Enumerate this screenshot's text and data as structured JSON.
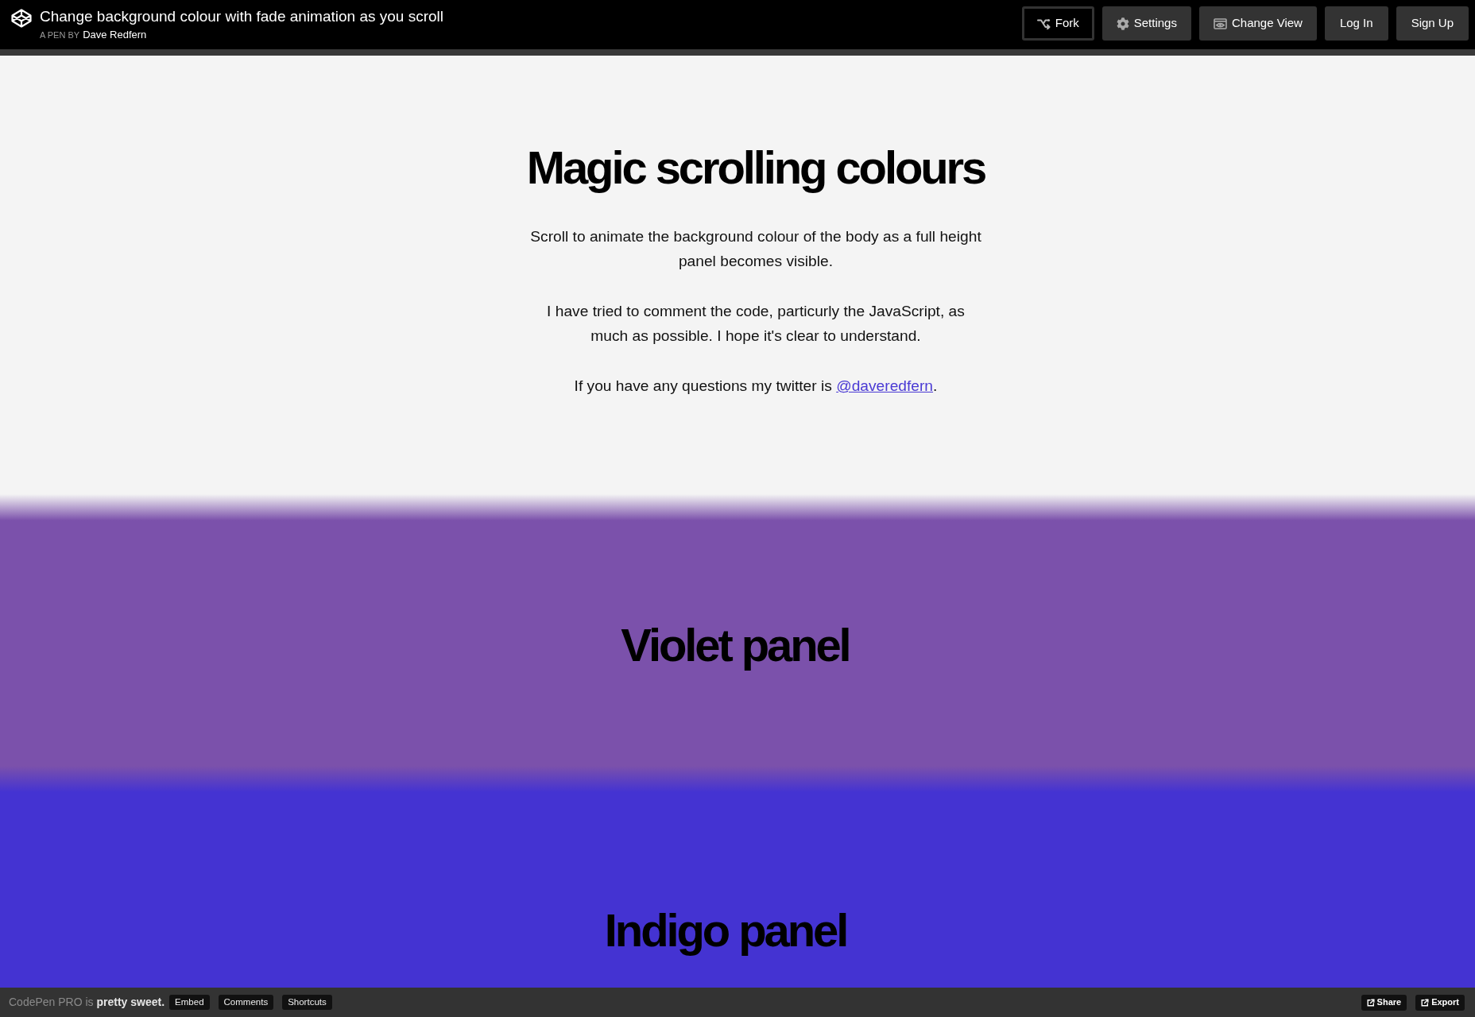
{
  "header": {
    "title": "Change background colour with fade animation as you scroll",
    "byline_label": "A PEN BY",
    "author": "Dave Redfern",
    "buttons": [
      {
        "label": "Fork",
        "kind": "fork"
      },
      {
        "label": "Settings",
        "kind": "settings"
      },
      {
        "label": "Change View",
        "kind": "view"
      },
      {
        "label": "Log In",
        "kind": "login"
      },
      {
        "label": "Sign Up",
        "kind": "signup"
      }
    ]
  },
  "intro": {
    "title": "Magic scrolling colours",
    "paragraphs": [
      "Scroll to animate the background colour of the body as a full height panel becomes visible.",
      "I have tried to comment the code, particurly the JavaScript, as much as possible. I hope it's clear to understand."
    ],
    "contact": {
      "text": "If you have any questions my twitter is",
      "link": "@daveredfern",
      "suffix": "."
    }
  },
  "panels": [
    {
      "heading": "Violet panel",
      "color": "#7b51ab"
    },
    {
      "heading": "Indigo panel",
      "color": "#4433d2"
    }
  ],
  "footer": {
    "tagline": "CodePen PRO is **pretty sweet.**",
    "left_buttons": [
      "Embed",
      "Comments",
      "Shortcuts"
    ],
    "right_buttons": [
      "Share",
      "Export"
    ]
  }
}
